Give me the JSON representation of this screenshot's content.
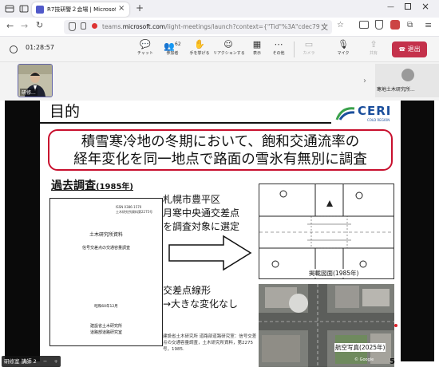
{
  "browser": {
    "tab_title": "R7技研警２会場 | Microsoft",
    "url_prefix": "teams.",
    "url_domain": "microsoft.com",
    "url_rest": "/light-meetings/launch?context={\"Tid\"%3A\"cdec79",
    "close_tab": "×",
    "new_tab": "+"
  },
  "meeting": {
    "timer": "01:28:57",
    "toolbar": [
      {
        "label": "チャット",
        "icon": "chat-icon",
        "glyph": "💬",
        "badge": ""
      },
      {
        "label": "参加者",
        "icon": "people-icon",
        "glyph": "👥",
        "badge": "62"
      },
      {
        "label": "手を挙げる",
        "icon": "hand-icon",
        "glyph": "✋",
        "badge": ""
      },
      {
        "label": "リアクションする",
        "icon": "reaction-icon",
        "glyph": "☺",
        "badge": ""
      },
      {
        "label": "表示",
        "icon": "view-icon",
        "glyph": "▦",
        "badge": ""
      },
      {
        "label": "その他",
        "icon": "more-icon",
        "glyph": "⋯",
        "badge": ""
      },
      {
        "label": "カメラ",
        "icon": "camera-off-icon",
        "glyph": "▭",
        "badge": ""
      },
      {
        "label": "マイク",
        "icon": "mic-off-icon",
        "glyph": "🎙",
        "badge": ""
      },
      {
        "label": "共有",
        "icon": "share-icon",
        "glyph": "⇪",
        "badge": ""
      }
    ],
    "leave_label": "退出",
    "participants": {
      "left_label": "研修...",
      "right_label": "寒地土木研究所..."
    },
    "bottom_label": "研修室 講師 2"
  },
  "slide": {
    "title": "目的",
    "logo_text": "CERI",
    "logo_sub": "COLD REGION",
    "headline_line1": "積雪寒冷地の冬期において、飽和交通流率の",
    "headline_line2": "経年変化を同一地点で路面の雪氷有無別に調査",
    "section_title": "過去調査",
    "section_year": "(1985年)",
    "doc": {
      "issn": "ISSN 0386-1570",
      "docno": "土木研究所資料第2275号",
      "title1": "土木研究所資料",
      "title2": "信号交差点の交通容量調査",
      "date": "昭和60年12月",
      "org1": "建設省土木研究所",
      "org2": "道路部道路研究室"
    },
    "site_line1": "札幌市豊平区",
    "site_line2": "月寒中央通交差点",
    "site_line3": "を調査対象に選定",
    "change_line1": "交差点線形",
    "change_line2": "→大きな変化なし",
    "citation": "建設省土木研究所 道路部道路研究室：信号交差点の交通容量調査，土木研究所資料，第2275号，1985.",
    "drawing_caption": "掲載図面(1985年)",
    "photo_caption": "航空写真(2025年)",
    "google_label": "© Google",
    "page_number": "5"
  },
  "colors": {
    "headline_border": "#c8102e",
    "ceri_blue": "#1b4f9c",
    "ceri_green": "#3aa14b",
    "leave_red": "#c4314b"
  }
}
